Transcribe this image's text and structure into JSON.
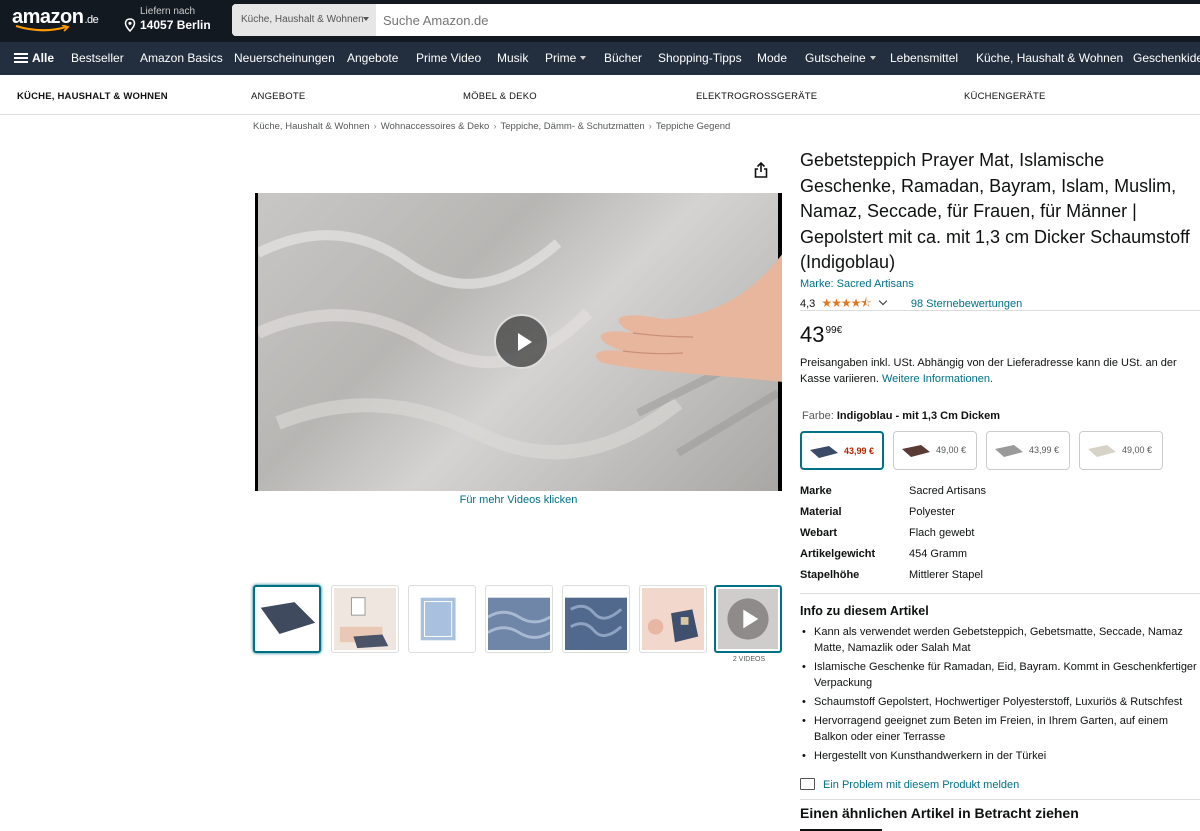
{
  "header": {
    "logo_text": "amazon",
    "logo_tld": ".de",
    "deliver_line1": "Liefern nach",
    "deliver_line2": "14057 Berlin",
    "search_category": "Küche, Haushalt & Wohnen",
    "search_placeholder": "Suche Amazon.de"
  },
  "nav": {
    "items": [
      "Alle",
      "Bestseller",
      "Amazon Basics",
      "Neuerscheinungen",
      "Angebote",
      "Prime Video",
      "Musik",
      "Prime",
      "Bücher",
      "Shopping-Tipps",
      "Mode",
      "Gutscheine",
      "Lebensmittel",
      "Küche, Haushalt & Wohnen",
      "Geschenkideen"
    ]
  },
  "subnav": {
    "items": [
      "KÜCHE, HAUSHALT & WOHNEN",
      "ANGEBOTE",
      "MÖBEL & DEKO",
      "ELEKTROGROSSGERÄTE",
      "KÜCHENGERÄTE"
    ]
  },
  "breadcrumb": [
    "Küche, Haushalt & Wohnen",
    "Wohnaccessoires & Deko",
    "Teppiche, Dämm- & Schutzmatten",
    "Teppiche Gegend"
  ],
  "media": {
    "more_videos": "Für mehr Videos klicken",
    "thumbs_caption": "2 VIDEOS"
  },
  "product": {
    "title": "Gebetsteppich Prayer Mat, Islamische Geschenke, Ramadan, Bayram, Islam, Muslim, Namaz, Seccade, für Frauen, für Männer | Gepolstert mit ca. mit 1,3 cm Dicker Schaumstoff (Indigoblau)",
    "brand": "Marke: Sacred Artisans",
    "rating_value": "4,3",
    "rating_stars": "★★★★⯪",
    "rating_count": "98 Sternebewertungen",
    "price_whole": "43",
    "price_fraction": "99",
    "price_currency": "€",
    "tax_note": "Preisangaben inkl. USt. Abhängig von der Lieferadresse kann die USt. an der Kasse variieren.",
    "tax_link": "Weitere Informationen.",
    "color_label": "Farbe:",
    "color_value": "Indigoblau - mit 1,3 Cm Dickem",
    "swatches": [
      {
        "price": "43,99 €",
        "color": "#3b4a66"
      },
      {
        "price": "49,00 €",
        "color": "#5a3a34"
      },
      {
        "price": "43,99 €",
        "color": "#9a9a9a"
      },
      {
        "price": "49,00 €",
        "color": "#d8d3c8"
      }
    ],
    "specs": [
      {
        "key": "Marke",
        "value": "Sacred Artisans"
      },
      {
        "key": "Material",
        "value": "Polyester"
      },
      {
        "key": "Webart",
        "value": "Flach gewebt"
      },
      {
        "key": "Artikelgewicht",
        "value": "454 Gramm"
      },
      {
        "key": "Stapelhöhe",
        "value": "Mittlerer Stapel"
      }
    ],
    "about_heading": "Info zu diesem Artikel",
    "bullets": [
      "Kann als verwendet werden Gebetsteppich, Gebetsmatte, Seccade, Namaz Matte, Namazlik oder Salah Mat",
      "Islamische Geschenke für Ramadan, Eid, Bayram. Kommt in Geschenkfertiger Verpackung",
      "Schaumstoff Gepolstert, Hochwertiger Polyesterstoff, Luxuriös & Rutschfest",
      "Hervorragend geeignet zum Beten im Freien, in Ihrem Garten, auf einem Balkon oder einer Terrasse",
      "Hergestellt von Kunsthandwerkern in der Türkei"
    ],
    "report_link": "Ein Problem mit diesem Produkt melden",
    "similar_heading": "Einen ähnlichen Artikel in Betracht ziehen"
  },
  "colors": {
    "header_bg": "#131921",
    "nav_bg": "#232f3e",
    "link": "#007185",
    "star": "#de7921",
    "price_red": "#b12704"
  }
}
